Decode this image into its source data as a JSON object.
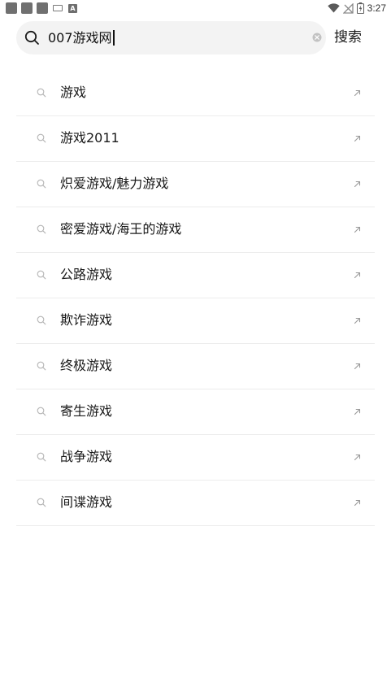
{
  "status_bar": {
    "time": "3:27",
    "keyboard_letter": "A"
  },
  "search": {
    "query": "007游戏网",
    "button_label": "搜索"
  },
  "suggestions": [
    {
      "label": "游戏"
    },
    {
      "label": "游戏2011"
    },
    {
      "label": "炽爱游戏/魅力游戏"
    },
    {
      "label": "密爱游戏/海王的游戏"
    },
    {
      "label": "公路游戏"
    },
    {
      "label": "欺诈游戏"
    },
    {
      "label": "终极游戏"
    },
    {
      "label": "寄生游戏"
    },
    {
      "label": "战争游戏"
    },
    {
      "label": "间谍游戏"
    }
  ],
  "icons": {
    "status_left": [
      "app-notification-icon",
      "app-notification-icon",
      "app-notification-icon",
      "keyboard-icon",
      "input-method-icon"
    ],
    "status_right": [
      "wifi-icon",
      "no-signal-icon",
      "battery-icon"
    ],
    "search_box": [
      "search-icon",
      "clear-icon"
    ],
    "suggestion_row": [
      "search-icon",
      "fill-arrow-icon"
    ]
  },
  "colors": {
    "search_box_bg": "#f3f3f3",
    "divider": "#ececec",
    "text": "#1a1a1a",
    "muted_icon": "#b5b5b5"
  }
}
